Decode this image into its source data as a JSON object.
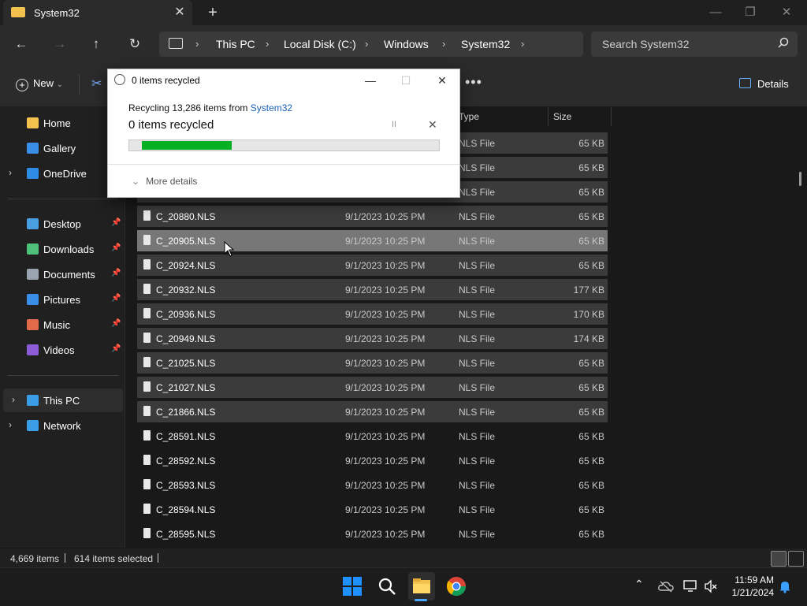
{
  "window": {
    "tab_title": "System32",
    "new_tab": "+",
    "close_tab": "✕",
    "minimize": "—",
    "restore": "❐",
    "close": "✕"
  },
  "nav": {
    "back": "←",
    "forward": "→",
    "up": "↑",
    "refresh": "↻",
    "breadcrumbs": [
      "This PC",
      "Local Disk (C:)",
      "Windows",
      "System32"
    ],
    "sep": "›",
    "search_placeholder": "Search System32"
  },
  "command_bar": {
    "new_label": "New",
    "new_caret": "⌄",
    "more": "•••",
    "details_label": "Details"
  },
  "sidebar": {
    "top_items": [
      {
        "label": "Home",
        "icon": "home-icon",
        "color": "#f2c14e"
      },
      {
        "label": "Gallery",
        "icon": "gallery-icon",
        "color": "#3a8ee6"
      },
      {
        "label": "OneDrive",
        "icon": "cloud-icon",
        "color": "#2f8ce6"
      }
    ],
    "pinned_items": [
      {
        "label": "Desktop",
        "icon": "desktop-icon",
        "color": "#4a9fe0"
      },
      {
        "label": "Downloads",
        "icon": "download-icon",
        "color": "#4ec07a"
      },
      {
        "label": "Documents",
        "icon": "document-icon",
        "color": "#9aa4b0"
      },
      {
        "label": "Pictures",
        "icon": "pictures-icon",
        "color": "#3a8ee6"
      },
      {
        "label": "Music",
        "icon": "music-icon",
        "color": "#e06a4a"
      },
      {
        "label": "Videos",
        "icon": "videos-icon",
        "color": "#8b5cd6"
      }
    ],
    "bottom_items": [
      {
        "label": "This PC",
        "icon": "computer-icon",
        "color": "#3a9ee6"
      },
      {
        "label": "Network",
        "icon": "network-icon",
        "color": "#3a9ee6"
      }
    ],
    "pin": "📌"
  },
  "columns": {
    "type": "Type",
    "size": "Size"
  },
  "files": [
    {
      "name": "",
      "date": "",
      "type": "NLS File",
      "size": "65 KB",
      "state": "sel"
    },
    {
      "name": "",
      "date": "",
      "type": "NLS File",
      "size": "65 KB",
      "state": "sel"
    },
    {
      "name": "",
      "date": "",
      "type": "NLS File",
      "size": "65 KB",
      "state": "sel"
    },
    {
      "name": "C_20880.NLS",
      "date": "9/1/2023 10:25 PM",
      "type": "NLS File",
      "size": "65 KB",
      "state": "sel"
    },
    {
      "name": "C_20905.NLS",
      "date": "9/1/2023 10:25 PM",
      "type": "NLS File",
      "size": "65 KB",
      "state": "hl"
    },
    {
      "name": "C_20924.NLS",
      "date": "9/1/2023 10:25 PM",
      "type": "NLS File",
      "size": "65 KB",
      "state": "sel"
    },
    {
      "name": "C_20932.NLS",
      "date": "9/1/2023 10:25 PM",
      "type": "NLS File",
      "size": "177 KB",
      "state": "sel"
    },
    {
      "name": "C_20936.NLS",
      "date": "9/1/2023 10:25 PM",
      "type": "NLS File",
      "size": "170 KB",
      "state": "sel"
    },
    {
      "name": "C_20949.NLS",
      "date": "9/1/2023 10:25 PM",
      "type": "NLS File",
      "size": "174 KB",
      "state": "sel"
    },
    {
      "name": "C_21025.NLS",
      "date": "9/1/2023 10:25 PM",
      "type": "NLS File",
      "size": "65 KB",
      "state": "sel"
    },
    {
      "name": "C_21027.NLS",
      "date": "9/1/2023 10:25 PM",
      "type": "NLS File",
      "size": "65 KB",
      "state": "sel"
    },
    {
      "name": "C_21866.NLS",
      "date": "9/1/2023 10:25 PM",
      "type": "NLS File",
      "size": "65 KB",
      "state": "sel"
    },
    {
      "name": "C_28591.NLS",
      "date": "9/1/2023 10:25 PM",
      "type": "NLS File",
      "size": "65 KB",
      "state": ""
    },
    {
      "name": "C_28592.NLS",
      "date": "9/1/2023 10:25 PM",
      "type": "NLS File",
      "size": "65 KB",
      "state": ""
    },
    {
      "name": "C_28593.NLS",
      "date": "9/1/2023 10:25 PM",
      "type": "NLS File",
      "size": "65 KB",
      "state": ""
    },
    {
      "name": "C_28594.NLS",
      "date": "9/1/2023 10:25 PM",
      "type": "NLS File",
      "size": "65 KB",
      "state": ""
    },
    {
      "name": "C_28595.NLS",
      "date": "9/1/2023 10:25 PM",
      "type": "NLS File",
      "size": "65 KB",
      "state": ""
    }
  ],
  "status": {
    "items": "4,669 items",
    "selected": "614 items selected"
  },
  "dialog": {
    "title": "0 items recycled",
    "subtitle_prefix": "Recycling 13,286 items from ",
    "subtitle_link": "System32",
    "big_text": "0 items recycled",
    "progress_fraction": 0.33,
    "pause": "II",
    "cancel": "✕",
    "more_details": "More details",
    "chevron": "⌄",
    "minimize": "—",
    "maximize": "☐",
    "close": "✕"
  },
  "taskbar": {
    "time": "11:59 AM",
    "date": "1/21/2024",
    "tray_chevron": "⌃"
  }
}
